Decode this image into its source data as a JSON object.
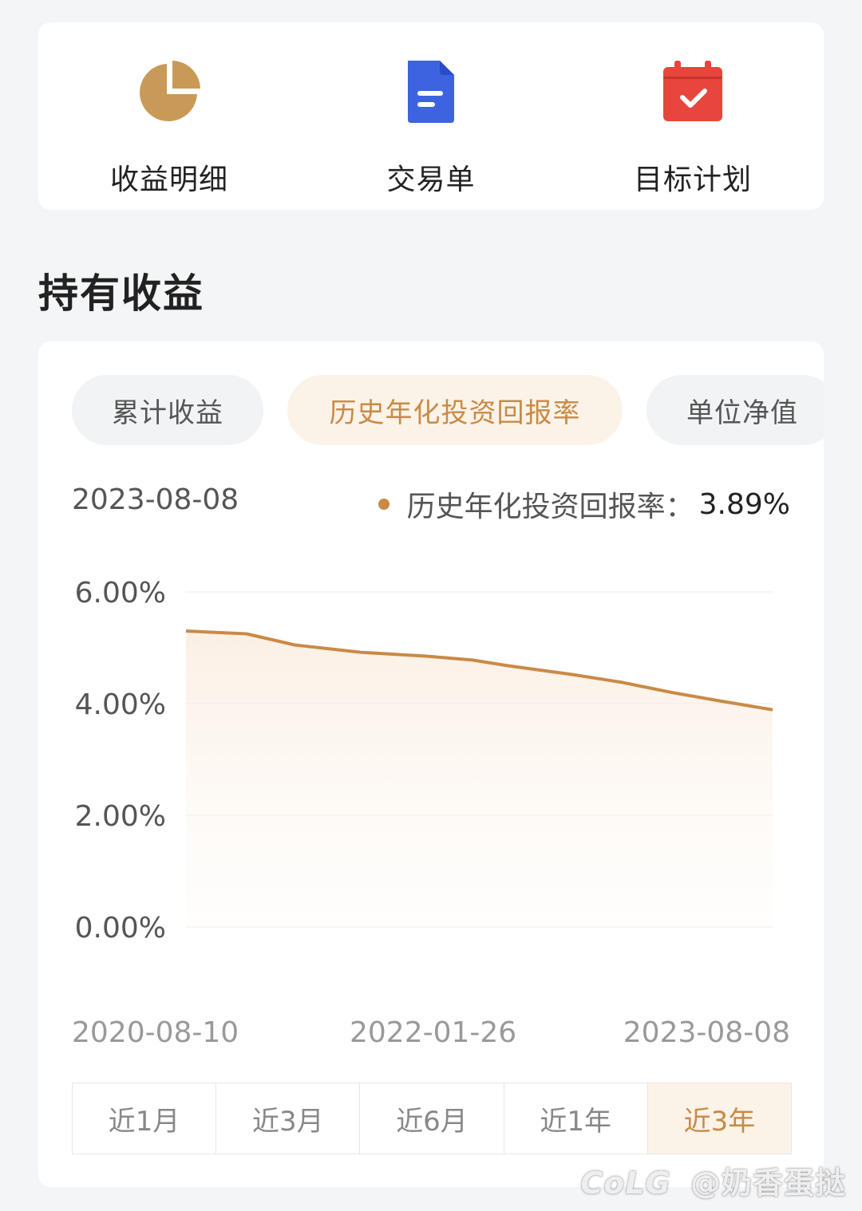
{
  "quick_actions": [
    {
      "label": "收益明细",
      "icon": "pie-chart-icon",
      "color": "#c99a57"
    },
    {
      "label": "交易单",
      "icon": "document-icon",
      "color": "#3d63e0"
    },
    {
      "label": "目标计划",
      "icon": "calendar-check-icon",
      "color": "#e8453c"
    }
  ],
  "section_title": "持有收益",
  "chart_tabs": [
    {
      "label": "累计收益",
      "active": false
    },
    {
      "label": "历史年化投资回报率",
      "active": true
    },
    {
      "label": "单位净值",
      "active": false
    }
  ],
  "tooltip": {
    "date": "2023-08-08",
    "series_label": "历史年化投资回报率：",
    "value": "3.89%"
  },
  "chart_data": {
    "type": "area",
    "title": "",
    "xlabel": "",
    "ylabel": "",
    "y_ticks": [
      "6.00%",
      "4.00%",
      "2.00%",
      "0.00%"
    ],
    "ylim": [
      0,
      6
    ],
    "x_ticks": [
      "2020-08-10",
      "2022-01-26",
      "2023-08-08"
    ],
    "x": [
      "2020-08-10",
      "2020-12-01",
      "2021-03-01",
      "2021-07-01",
      "2021-11-01",
      "2022-01-26",
      "2022-04-01",
      "2022-08-01",
      "2022-11-01",
      "2023-02-01",
      "2023-05-01",
      "2023-08-08"
    ],
    "series": [
      {
        "name": "历史年化投资回报率",
        "color": "#c98a46",
        "values": [
          5.3,
          5.25,
          5.05,
          4.92,
          4.85,
          4.78,
          4.68,
          4.52,
          4.38,
          4.2,
          4.05,
          3.89
        ]
      }
    ],
    "grid": true
  },
  "range_options": [
    {
      "label": "近1月",
      "active": false
    },
    {
      "label": "近3月",
      "active": false
    },
    {
      "label": "近6月",
      "active": false
    },
    {
      "label": "近1年",
      "active": false
    },
    {
      "label": "近3年",
      "active": true
    }
  ],
  "watermark": {
    "logo": "CoLG",
    "handle": "@奶香蛋挞"
  }
}
